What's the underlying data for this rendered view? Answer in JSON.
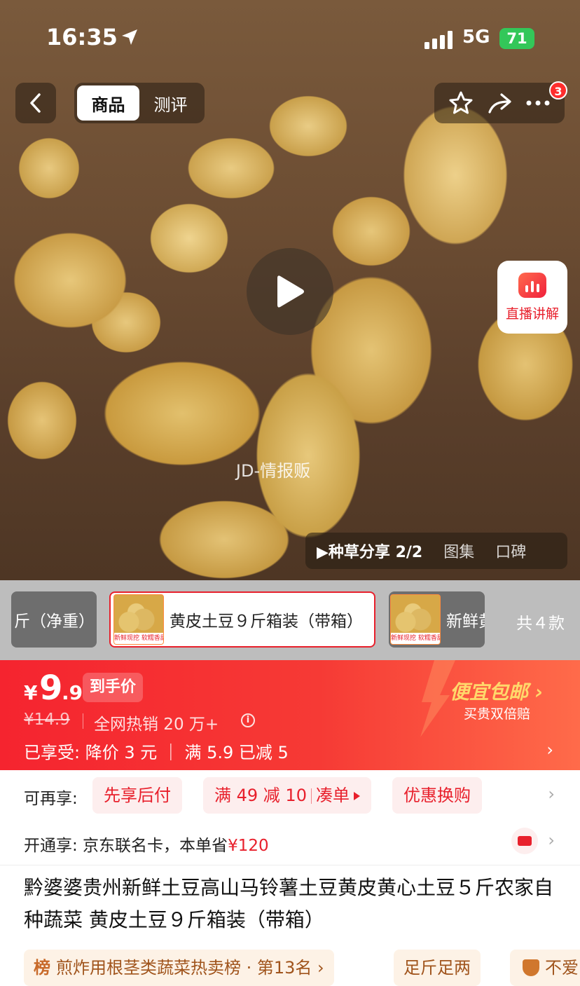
{
  "status_bar": {
    "time": "16:35",
    "network": "5G",
    "battery": "71"
  },
  "nav": {
    "tabs": [
      {
        "label": "商品",
        "active": true
      },
      {
        "label": "测评",
        "active": false
      }
    ],
    "badge_count": "3"
  },
  "hero": {
    "watermark": "JD-情报贩",
    "live_label": "直播讲解"
  },
  "media_tabs": [
    {
      "label": "▶种草分享 2/2",
      "active": true
    },
    {
      "label": "图集",
      "active": false
    },
    {
      "label": "口碑",
      "active": false
    }
  ],
  "variants": {
    "items": [
      {
        "label": "斤（净重）",
        "selected": false
      },
      {
        "label": "黄皮土豆９斤箱装（带箱）",
        "selected": true
      },
      {
        "label": "新鲜黄",
        "selected": false
      }
    ],
    "thumb_caption": "新鲜现挖 软糯香甜",
    "count_label": "共４款"
  },
  "price": {
    "currency": "¥",
    "integer": "9",
    "decimal": ".9",
    "tag": "到手价",
    "original": "¥14.9",
    "hot_sales": "全网热销 20 万+",
    "enjoyed": "已享受: 降价 3 元 ｜ 满 5.9 已减 5",
    "shipping_title": "便宜包邮 ›",
    "shipping_sub": "买贵双倍赔"
  },
  "promo_row": {
    "label": "可再享:",
    "pills": [
      "先享后付",
      "满 49 减 10",
      "凑单",
      "优惠换购"
    ]
  },
  "card_row": {
    "label": "开通享: 京东联名卡，本单省",
    "amount": "¥120"
  },
  "product_title": "黔婆婆贵州新鲜土豆高山马铃薯土豆黄皮黄心土豆５斤农家自种蔬菜 黄皮土豆９斤箱装（带箱）",
  "tags": {
    "rank_icon": "榜",
    "rank": "煎炸用根茎类蔬菜热卖榜 · 第13名 ›",
    "weight": "足斤足两",
    "guarantee": "不爱"
  },
  "colors": {
    "accent": "#e8202c",
    "price_band": "#f5242f",
    "shipping_gold": "#ffd86b"
  }
}
